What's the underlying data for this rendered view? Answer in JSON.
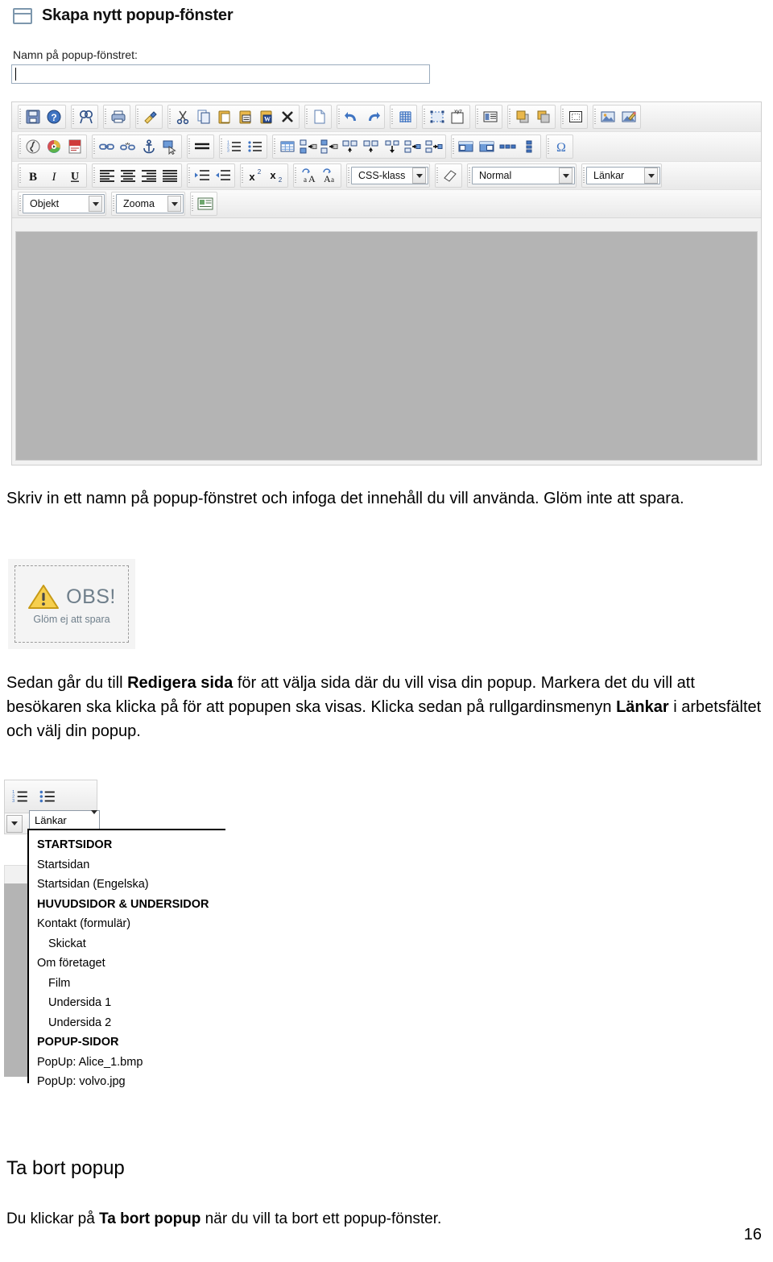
{
  "header": {
    "icon": "window-icon",
    "title": "Skapa nytt popup-fönster"
  },
  "form": {
    "name_label": "Namn på popup-fönstret:",
    "name_value": "",
    "name_placeholder": ""
  },
  "editor": {
    "toolbar_row1": [
      {
        "name": "save-icon",
        "title": "Spara"
      },
      {
        "name": "help-icon",
        "title": "Hjälp"
      },
      {
        "name": "find-icon",
        "title": "Sök"
      },
      {
        "name": "print-preview-icon",
        "title": "Förhandsgranska"
      },
      {
        "name": "format-painter-icon",
        "title": "Formatpensel"
      },
      {
        "name": "cut-icon",
        "title": "Klipp ut"
      },
      {
        "name": "copy-icon",
        "title": "Kopiera"
      },
      {
        "name": "paste-icon",
        "title": "Klistra in"
      },
      {
        "name": "paste-text-icon",
        "title": "Klistra in text"
      },
      {
        "name": "paste-word-icon",
        "title": "Klistra in från Word"
      },
      {
        "name": "delete-icon",
        "title": "Ta bort"
      },
      {
        "name": "new-page-icon",
        "title": "Ny sida"
      },
      {
        "name": "undo-icon",
        "title": "Ångra"
      },
      {
        "name": "redo-icon",
        "title": "Gör om"
      },
      {
        "name": "grid-icon",
        "title": "Rutnät"
      },
      {
        "name": "select-area-icon",
        "title": "Markera område"
      },
      {
        "name": "xyz-icon",
        "title": "XYZ"
      },
      {
        "name": "align-text-icon",
        "title": "Textflöde"
      },
      {
        "name": "bring-front-icon",
        "title": "Flytta framåt"
      },
      {
        "name": "send-back-icon",
        "title": "Flytta bakåt"
      },
      {
        "name": "dotted-box-icon",
        "title": "Ram"
      },
      {
        "name": "image-icon",
        "title": "Bild"
      },
      {
        "name": "edit-image-icon",
        "title": "Redigera bild"
      }
    ],
    "toolbar_row2": [
      {
        "name": "flash-icon",
        "title": "Flash"
      },
      {
        "name": "media-icon",
        "title": "Media"
      },
      {
        "name": "pdf-icon",
        "title": "PDF"
      },
      {
        "name": "link-icon",
        "title": "Länk"
      },
      {
        "name": "unlink-icon",
        "title": "Ta bort länk"
      },
      {
        "name": "anchor-icon",
        "title": "Ankare"
      },
      {
        "name": "hotspot-icon",
        "title": "Hotspot"
      },
      {
        "name": "horizontal-rule-icon",
        "title": "Linje"
      },
      {
        "name": "ordered-list-icon",
        "title": "Numrerad lista"
      },
      {
        "name": "unordered-list-icon",
        "title": "Punktlista"
      },
      {
        "name": "table-icon",
        "title": "Tabell"
      },
      {
        "name": "insert-col-left-icon",
        "title": "Infoga kolumn vänster"
      },
      {
        "name": "insert-col-right-icon",
        "title": "Infoga kolumn höger"
      },
      {
        "name": "insert-row-above-icon",
        "title": "Infoga rad ovanför"
      },
      {
        "name": "insert-row-below-icon",
        "title": "Infoga rad under"
      },
      {
        "name": "delete-row-icon",
        "title": "Ta bort rad"
      },
      {
        "name": "merge-cells-icon",
        "title": "Slå ihop celler"
      },
      {
        "name": "split-cells-icon",
        "title": "Dela celler"
      },
      {
        "name": "cell-props-icon",
        "title": "Cellegenskaper"
      },
      {
        "name": "table-props-icon",
        "title": "Tabellegenskaper"
      },
      {
        "name": "cell-width-icon",
        "title": "Cellbredd"
      },
      {
        "name": "cell-height-icon",
        "title": "Cellhöjd"
      },
      {
        "name": "special-char-icon",
        "title": "Specialtecken"
      }
    ],
    "toolbar_row3": [
      {
        "name": "bold-icon",
        "label": "B"
      },
      {
        "name": "italic-icon",
        "label": "I"
      },
      {
        "name": "underline-icon",
        "label": "U"
      },
      {
        "name": "align-left-icon",
        "title": "Vänsterjustera"
      },
      {
        "name": "align-center-icon",
        "title": "Centrera"
      },
      {
        "name": "align-right-icon",
        "title": "Högerjustera"
      },
      {
        "name": "align-justify-icon",
        "title": "Marginaljustera"
      },
      {
        "name": "indent-increase-icon",
        "title": "Öka indrag"
      },
      {
        "name": "indent-decrease-icon",
        "title": "Minska indrag"
      },
      {
        "name": "superscript-icon",
        "title": "Upphöjd"
      },
      {
        "name": "subscript-icon",
        "title": "Nedsänkt"
      },
      {
        "name": "uppercase-icon",
        "title": "Versaler"
      },
      {
        "name": "lowercase-icon",
        "title": "Gemener"
      },
      {
        "name": "eraser-icon",
        "title": "Rensa formatering"
      }
    ],
    "combos": {
      "css_class": "CSS-klass",
      "style": "Normal",
      "links": "Länkar",
      "object": "Objekt",
      "zoom": "Zooma"
    },
    "row4_icon": {
      "name": "page-properties-icon",
      "title": "Sidegenskaper"
    },
    "canvas_color": "#b4b4b4"
  },
  "paragraph1": {
    "text": "Skriv in ett namn på popup-fönstret och infoga det innehåll du vill använda. Glöm inte att spara."
  },
  "obs_box": {
    "icon": "warning-triangle-icon",
    "word": "OBS!",
    "subtitle": "Glöm ej att spara",
    "accent": "#f4c430",
    "text_color": "#6f7f8b"
  },
  "paragraph2": {
    "part1": "Sedan går du till ",
    "bold1": "Redigera sida",
    "part2": " för att välja sida där du vill visa din popup. Markera det du vill att besökaren ska klicka på för att popupen ska visas. Klicka sedan på rullgardinsmenyn ",
    "bold2": "Länkar",
    "part3": " i arbetsfältet och välj din popup."
  },
  "dropdown_shot": {
    "combo_label": "Länkar",
    "toolbar_icons": [
      {
        "name": "ordered-list-icon"
      },
      {
        "name": "unordered-list-icon"
      }
    ],
    "items": [
      {
        "label": "STARTSIDOR",
        "type": "header",
        "indent": 0
      },
      {
        "label": "Startsidan",
        "type": "item",
        "indent": 0
      },
      {
        "label": "Startsidan (Engelska)",
        "type": "item",
        "indent": 0
      },
      {
        "label": "HUVUDSIDOR & UNDERSIDOR",
        "type": "header",
        "indent": 0
      },
      {
        "label": "Kontakt (formulär)",
        "type": "item",
        "indent": 0
      },
      {
        "label": "Skickat",
        "type": "item",
        "indent": 1
      },
      {
        "label": "Om företaget",
        "type": "item",
        "indent": 0
      },
      {
        "label": "Film",
        "type": "item",
        "indent": 1
      },
      {
        "label": "Undersida 1",
        "type": "item",
        "indent": 1
      },
      {
        "label": "Undersida 2",
        "type": "item",
        "indent": 1
      },
      {
        "label": "POPUP-SIDOR",
        "type": "header",
        "indent": 0
      },
      {
        "label": "PopUp: Alice_1.bmp",
        "type": "item",
        "indent": 0
      },
      {
        "label": "PopUp: volvo.jpg",
        "type": "item",
        "indent": 0
      }
    ]
  },
  "section_heading": "Ta bort popup",
  "paragraph3": {
    "part1": "Du klickar på ",
    "bold1": "Ta bort popup",
    "part2": " när du vill ta bort ett popup-fönster."
  },
  "page_number": "16"
}
